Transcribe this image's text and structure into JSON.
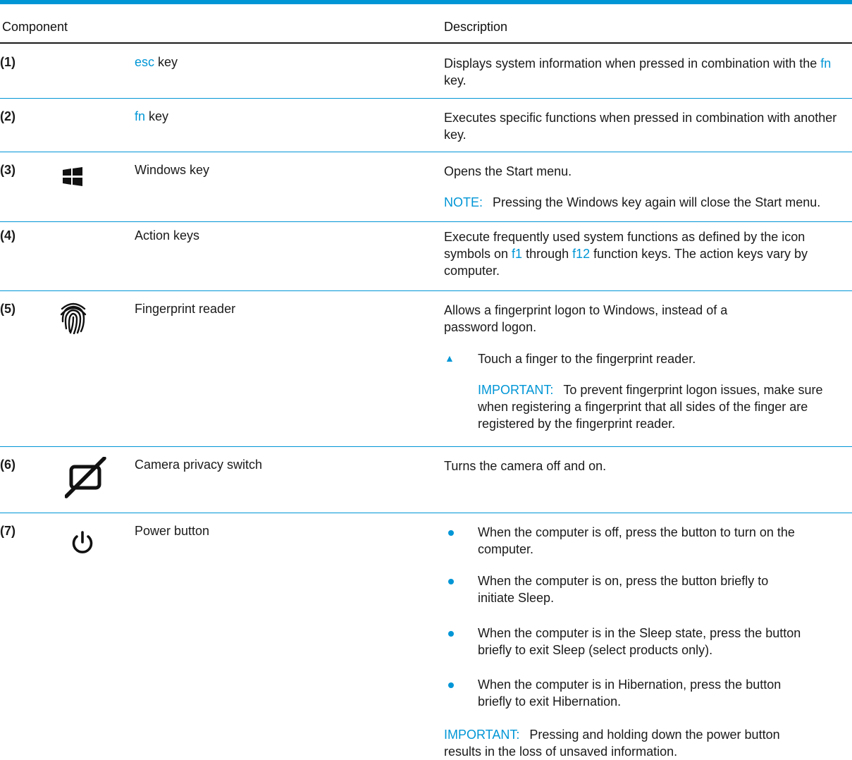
{
  "header": {
    "component": "Component",
    "description": "Description"
  },
  "rows": [
    {
      "num": "(1)",
      "name_link": "esc",
      "name_rest": " key",
      "desc_a": "Displays system information when pressed in combination with the ",
      "desc_link": "fn",
      "desc_b": " key."
    },
    {
      "num": "(2)",
      "name_link": "fn",
      "name_rest": " key",
      "desc": "Executes specific functions when pressed in combination with another key."
    },
    {
      "num": "(3)",
      "icon": "windows-logo-icon",
      "name": "Windows key",
      "desc": "Opens the Start menu.",
      "note_label": "NOTE:",
      "note_text": "Pressing the Windows key again will close the Start menu."
    },
    {
      "num": "(4)",
      "name": "Action keys",
      "desc_a": "Execute frequently used system functions as defined by the icon symbols on ",
      "desc_link1": "f1",
      "desc_b": " through ",
      "desc_link2": "f12",
      "desc_c": " function keys. The action keys vary by computer."
    },
    {
      "num": "(5)",
      "icon": "fingerprint-icon",
      "name": "Fingerprint reader",
      "desc": "Allows a fingerprint logon to Windows, instead of a password logon.",
      "step_marker": "▲",
      "step": "Touch a finger to the fingerprint reader.",
      "important_label": "IMPORTANT:",
      "important_text": "To prevent fingerprint logon issues, make sure when registering a fingerprint that all sides of the finger are registered by the fingerprint reader."
    },
    {
      "num": "(6)",
      "icon": "camera-privacy-icon",
      "name": "Camera privacy switch",
      "desc": "Turns the camera off and on."
    },
    {
      "num": "(7)",
      "icon": "power-icon",
      "name": "Power button",
      "bullets": [
        "When the computer is off, press the button to turn on the computer.",
        "When the computer is on, press the button briefly to initiate Sleep.",
        "When the computer is in the Sleep state, press the button briefly to exit Sleep (select products only).",
        "When the computer is in Hibernation, press the button briefly to exit Hibernation."
      ],
      "important_label": "IMPORTANT:",
      "important_text": "Pressing and holding down the power button results in the loss of unsaved information."
    }
  ],
  "colors": {
    "accent": "#0096d6",
    "text": "#1a1a1a"
  }
}
